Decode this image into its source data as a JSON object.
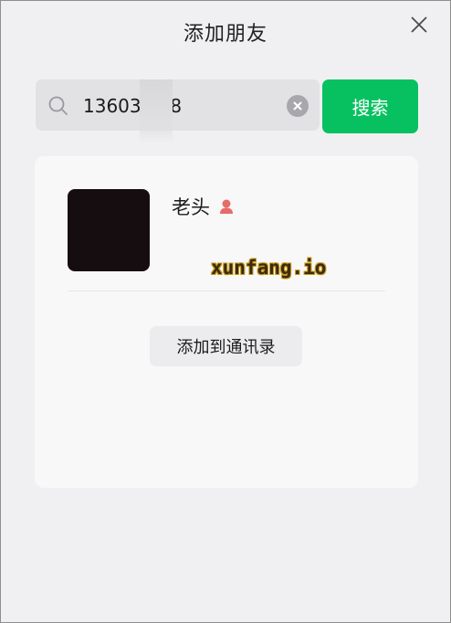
{
  "window": {
    "title": "添加朋友"
  },
  "search": {
    "value": "13603 938",
    "button_label": "搜索"
  },
  "result": {
    "name": "老头",
    "gender": "female",
    "avatar_color": "#160d11",
    "add_label": "添加到通讯录"
  },
  "watermark": {
    "text": "xunfang.io"
  },
  "colors": {
    "accent": "#07c160",
    "female_icon": "#e66b6b"
  }
}
